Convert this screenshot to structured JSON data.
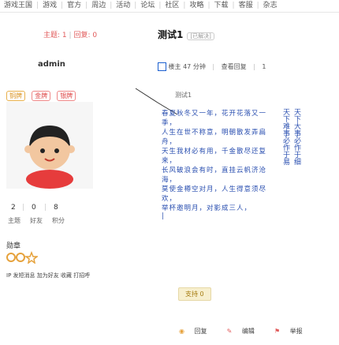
{
  "nav": [
    "游戏王国",
    "游戏",
    "官方",
    "周边",
    "活动",
    "论坛",
    "社区",
    "攻略",
    "下载",
    "客服",
    "杂志"
  ],
  "stats": {
    "a_label": "主题",
    "a_value": "1",
    "b_label": "回复",
    "b_value": "0"
  },
  "user": {
    "name": "admin",
    "chips": [
      "铜牌",
      "金牌",
      "银牌"
    ]
  },
  "profile_counts": [
    {
      "value": "2",
      "label": "主题"
    },
    {
      "value": "0",
      "label": "好友"
    },
    {
      "value": "8",
      "label": "积分"
    }
  ],
  "medals_label": "勋章",
  "bottom_row": [
    "IP",
    "发短消息",
    "加为好友",
    "收藏",
    "打招呼"
  ],
  "post": {
    "title": "测试1",
    "tag": "[已解决]",
    "meta": {
      "author": "楼主",
      "time": "47 分钟",
      "views": "查看回复",
      "count": "1"
    },
    "quote": "测试1",
    "body_lines": [
      "春夏秋冬又一年，花开花落又一季，",
      "人生在世不称意，明朝散发弄扁舟，",
      "天生我材必有用，千金散尽还复来，",
      "长风破浪会有时，直挂云帆济沧海，",
      "莫使金樽空对月，人生得意须尽欢，",
      "举杯邀明月，对影成三人，",
      "|"
    ],
    "side_lines": [
      "天下难事必作于易",
      "天下大事必作于细"
    ],
    "support_label": "支持",
    "support_count": "0",
    "actions": [
      "回复",
      "编辑",
      "举报"
    ]
  },
  "colors": {
    "accent": "#e15b5b",
    "poem": "#2a4fb0",
    "yellow": "#f7efce"
  }
}
